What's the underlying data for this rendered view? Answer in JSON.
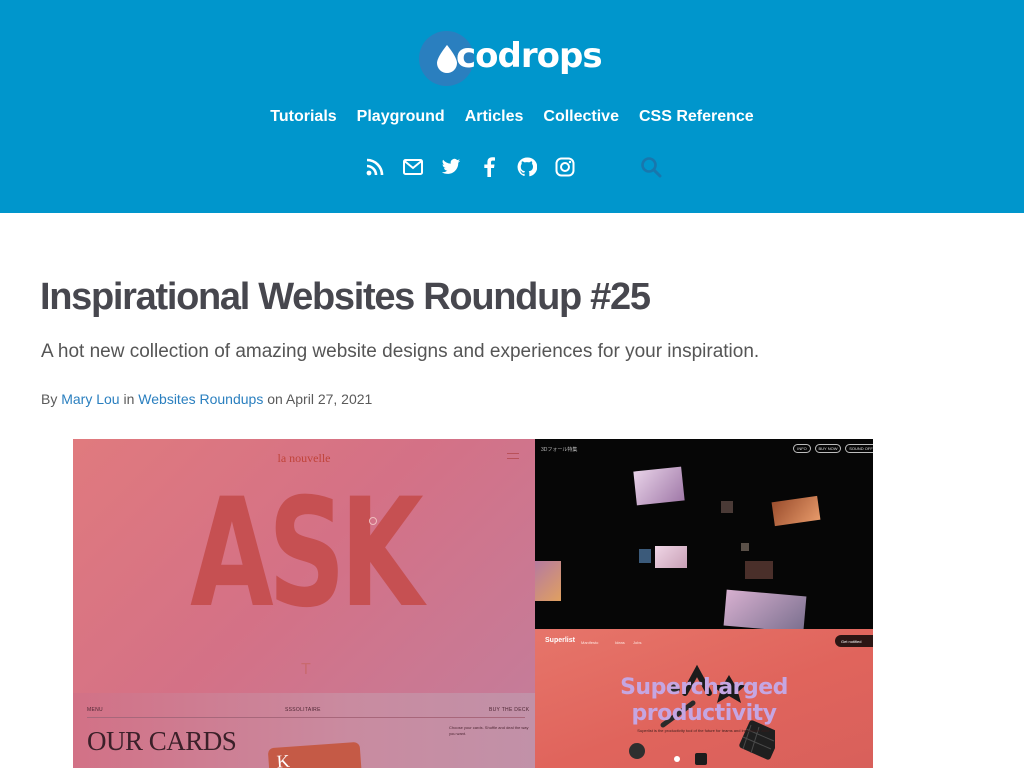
{
  "header": {
    "logo_text": "codrops",
    "bg_color": "#0096cc",
    "nav": [
      {
        "label": "Tutorials"
      },
      {
        "label": "Playground"
      },
      {
        "label": "Articles"
      },
      {
        "label": "Collective"
      },
      {
        "label": "CSS Reference"
      }
    ],
    "social": [
      "rss-icon",
      "mail-icon",
      "twitter-icon",
      "facebook-icon",
      "github-icon",
      "instagram-icon"
    ],
    "search_icon": "search-icon"
  },
  "article": {
    "title": "Inspirational Websites Roundup #25",
    "subtitle": "A hot new collection of amazing website designs and experiences for your inspiration.",
    "meta": {
      "by": "By",
      "author": "Mary Lou",
      "in": "in",
      "category": "Websites Roundups",
      "on": "on",
      "date": "April 27, 2021"
    },
    "link_color": "#2a7fbf"
  },
  "collage": {
    "panel_a": {
      "brand": "la nouvelle",
      "big_text": "ASK",
      "mark": "T"
    },
    "panel_b": {
      "menu": "MENU",
      "site": "SSSOLITAIRE",
      "buy": "BUY THE DECK",
      "heading": "OUR CARDS",
      "card_letter": "K",
      "copy": "Choose your cards. Shuffle and deal the way you want."
    },
    "panel_c": {
      "tag": "3Dフォール特集",
      "pills": [
        "INFO",
        "BUY NOW",
        "SOUND OFF"
      ]
    },
    "panel_d": {
      "brand": "Superlist",
      "nav": [
        "Manifesto",
        "Ideas",
        "Jobs"
      ],
      "cta": "Get notified",
      "hero_line1": "Supercharged",
      "hero_line2": "productivity",
      "sub": "Superlist is the productivity tool of the future for teams and individuals alike."
    }
  }
}
